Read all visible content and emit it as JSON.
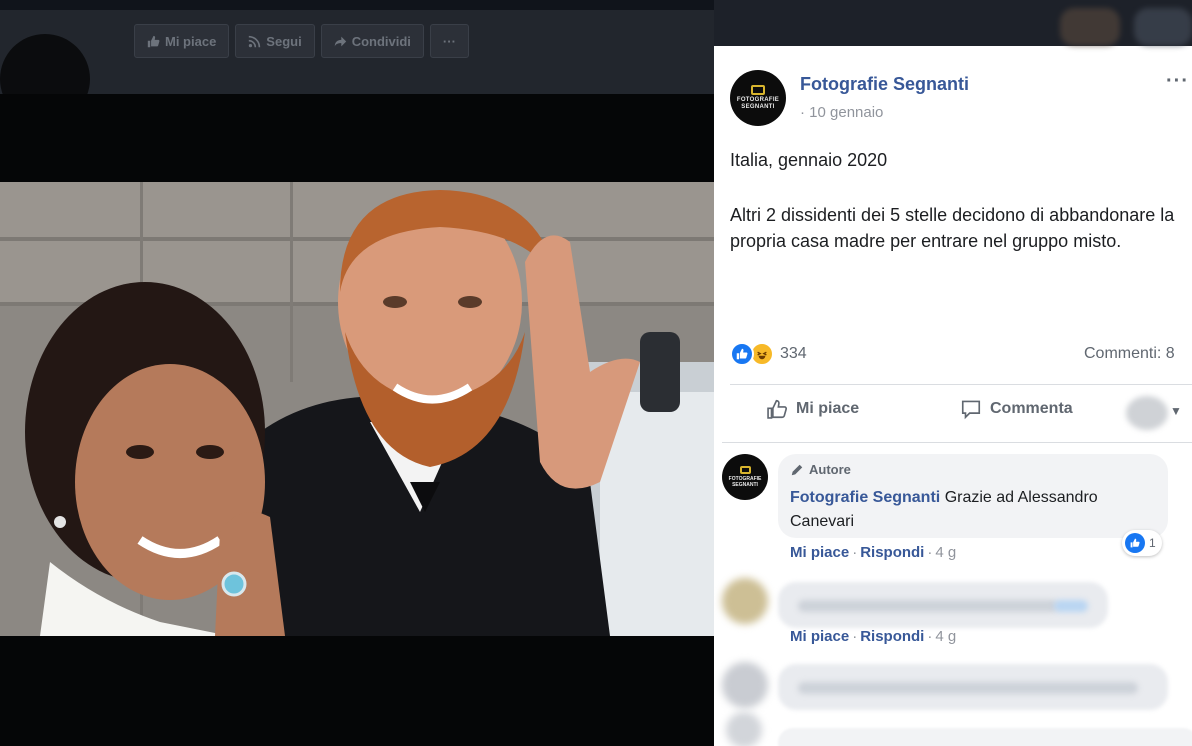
{
  "left_page": {
    "actions": [
      {
        "label": "Mi piace",
        "icon": "thumbs-up-icon"
      },
      {
        "label": "Segui",
        "icon": "rss-icon"
      },
      {
        "label": "Condividi",
        "icon": "share-icon"
      },
      {
        "label": "···",
        "icon": "more-icon"
      }
    ]
  },
  "post": {
    "author": "Fotografie Segnanti",
    "avatar_text_1": "FOTOGRAFIE",
    "avatar_text_2": "SEGNANTI",
    "date": "· 10 gennaio",
    "more": "···",
    "text_line1": "Italia, gennaio 2020",
    "text_body": "Altri 2 dissidenti dei 5 stelle decidono di abbandonare la propria casa madre per entrare nel gruppo misto.",
    "reaction_count": "334",
    "comments_count": "Commenti: 8",
    "actions": {
      "like": "Mi piace",
      "comment": "Commenta"
    }
  },
  "comments": [
    {
      "badge": "Autore",
      "author": "Fotografie Segnanti",
      "text": "Grazie ad Alessandro Canevari",
      "reaction_count": "1",
      "like": "Mi piace",
      "reply": "Rispondi",
      "time": "4 g"
    },
    {
      "like": "Mi piace",
      "reply": "Rispondi",
      "time": "4 g"
    }
  ],
  "colors": {
    "facebook_blue": "#385898",
    "like_blue": "#1877f2",
    "haha_yellow": "#f7b928"
  }
}
